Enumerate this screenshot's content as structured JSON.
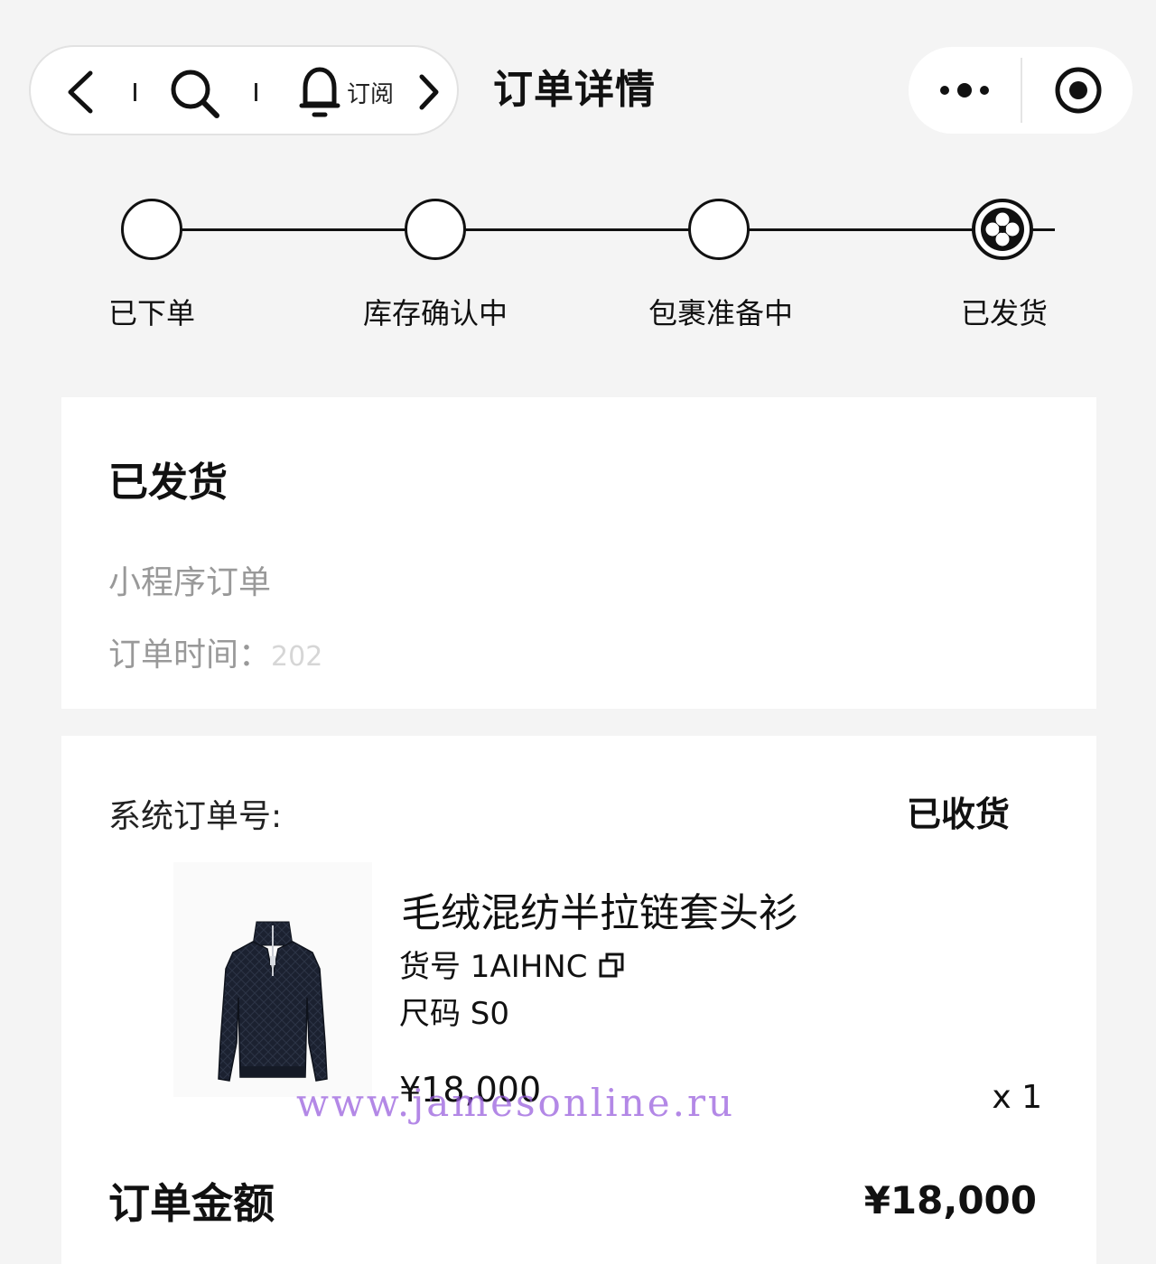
{
  "nav": {
    "back_icon": "chevron-left-icon",
    "search_icon": "search-icon",
    "bell_icon": "bell-icon",
    "subscribe_label": "订阅",
    "forward_icon": "chevron-right-icon"
  },
  "header": {
    "title": "订单详情",
    "more_icon": "more-dots-icon",
    "target_icon": "target-icon"
  },
  "tracker": {
    "current_index": 3,
    "steps": [
      {
        "label": "已下单"
      },
      {
        "label": "库存确认中"
      },
      {
        "label": "包裹准备中"
      },
      {
        "label": "已发货"
      }
    ]
  },
  "status_card": {
    "title": "已发货",
    "mini_program_order_label": "小程序订单",
    "order_time_label": "订单时间：",
    "order_time_value": "202"
  },
  "order_card": {
    "system_order_label": "系统订单号:",
    "order_status": "已收货",
    "product": {
      "name": "毛绒混纺半拉链套头衫",
      "sku_label": "货号 1AIHNC",
      "size_label": "尺码 S0",
      "price": "¥18,000",
      "quantity": "x 1"
    },
    "watermark": "www.jamesonline.ru",
    "total_label": "订单金额",
    "total_value": "¥18,000"
  },
  "colors": {
    "background": "#f4f4f4",
    "card": "#ffffff",
    "text": "#111111",
    "muted": "#999999",
    "watermark": "#9a5ce0"
  }
}
